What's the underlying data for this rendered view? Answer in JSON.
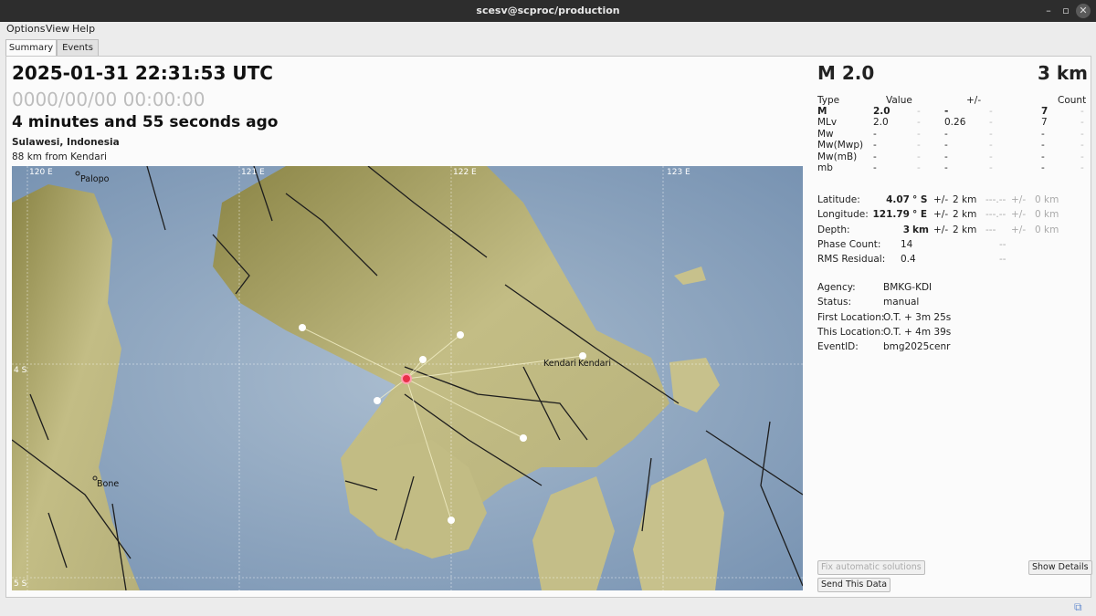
{
  "window": {
    "title": "scesv@scproc/production"
  },
  "menu": [
    "Options",
    "View",
    "Help"
  ],
  "tabs": [
    "Summary",
    "Events"
  ],
  "event": {
    "time": "2025-01-31 22:31:53 UTC",
    "placeholder_time": "0000/00/00  00:00:00",
    "ago": "4 minutes and 55 seconds ago",
    "region": "Sulawesi, Indonesia",
    "distance": "88 km from Kendari"
  },
  "summary": {
    "magnitude": "M 2.0",
    "depth": "3 km"
  },
  "mag_table": {
    "headers": {
      "type": "Type",
      "value": "Value",
      "pm": "+/-",
      "count": "Count"
    },
    "rows": [
      {
        "type": "M",
        "value": "2.0",
        "d1": "-",
        "pm": "-",
        "d2": "-",
        "count": "7",
        "d3": "-",
        "bold": true
      },
      {
        "type": "MLv",
        "value": "2.0",
        "d1": "-",
        "pm": "0.26",
        "d2": "-",
        "count": "7",
        "d3": "-"
      },
      {
        "type": "Mw",
        "value": "-",
        "d1": "-",
        "pm": "-",
        "d2": "-",
        "count": "-",
        "d3": "-"
      },
      {
        "type": "Mw(Mwp)",
        "value": "-",
        "d1": "-",
        "pm": "-",
        "d2": "-",
        "count": "-",
        "d3": "-"
      },
      {
        "type": "Mw(mB)",
        "value": "-",
        "d1": "-",
        "pm": "-",
        "d2": "-",
        "count": "-",
        "d3": "-"
      },
      {
        "type": "mb",
        "value": "-",
        "d1": "-",
        "pm": "-",
        "d2": "-",
        "count": "-",
        "d3": "-"
      }
    ]
  },
  "location": [
    {
      "label": "Latitude:",
      "value": "4.07",
      "unit": "° S",
      "pm": "+/-",
      "unc": "2 km",
      "alt": "---.--",
      "pm2": "+/-",
      "unc2": "0 km"
    },
    {
      "label": "Longitude:",
      "value": "121.79",
      "unit": "° E",
      "pm": "+/-",
      "unc": "2 km",
      "alt": "---.--",
      "pm2": "+/-",
      "unc2": "0 km"
    },
    {
      "label": "Depth:",
      "value": "3",
      "unit": "km",
      "pm": "+/-",
      "unc": "2 km",
      "alt": "---",
      "pm2": "+/-",
      "unc2": "0 km"
    },
    {
      "label": "Phase Count:",
      "value": "14",
      "alt": "--"
    },
    {
      "label": "RMS Residual:",
      "value": "0.4",
      "alt": "--"
    }
  ],
  "info": [
    {
      "label": "Agency:",
      "value": "BMKG-KDI"
    },
    {
      "label": "Status:",
      "value": "manual"
    },
    {
      "label": "First Location:",
      "value": "O.T. + 3m 25s"
    },
    {
      "label": "This Location:",
      "value": "O.T. + 4m 39s"
    },
    {
      "label": "EventID:",
      "value": "bmg2025cenr"
    }
  ],
  "buttons": {
    "fix": "Fix automatic solutions",
    "send": "Send This Data",
    "details": "Show Details"
  },
  "map": {
    "grid_labels": {
      "lon120": "120 E",
      "lon121": "121 E",
      "lon122": "122 E",
      "lon123": "123 E",
      "lat4": "4 S",
      "lat5": "5 S"
    },
    "cities": {
      "palopo": "Palopo",
      "bone": "Bone",
      "kendari1": "Kendari",
      "kendari2": "Kendari"
    },
    "colors": {
      "sea": "#8aa3bd",
      "land": "#c6c08a",
      "land_dark": "#8f8a4e",
      "station": "#ffffff",
      "epicenter": "#e8304a"
    }
  }
}
